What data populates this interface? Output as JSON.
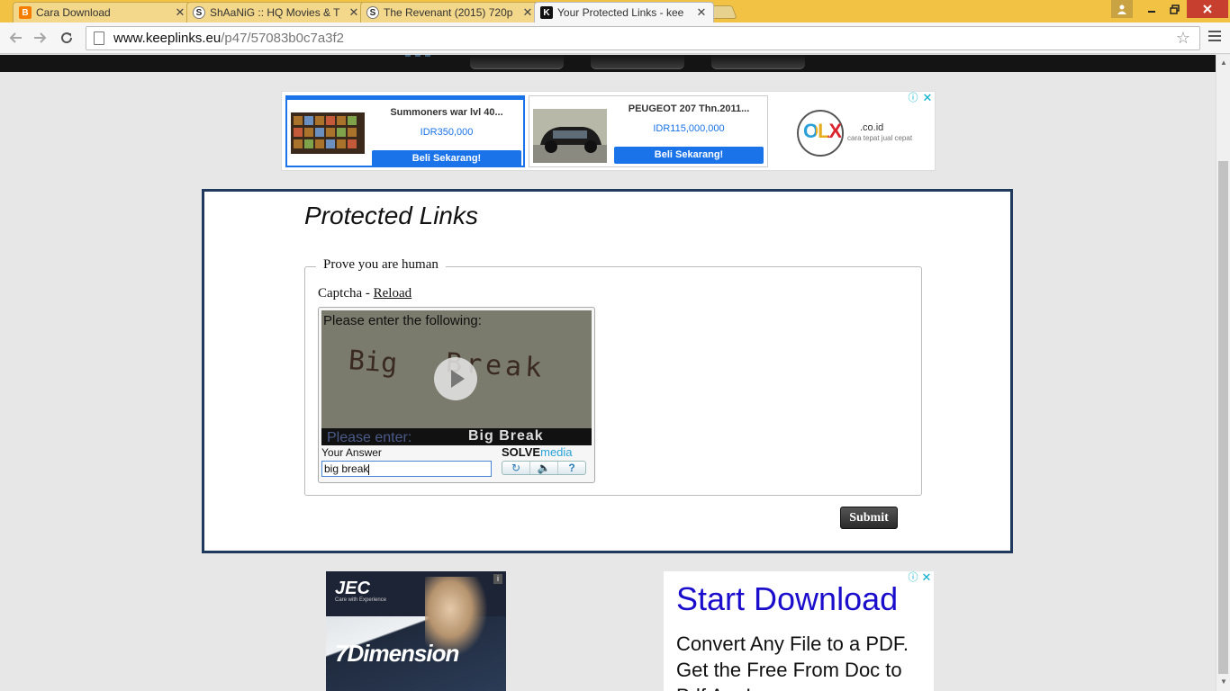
{
  "browser": {
    "tabs": [
      {
        "title": "Cara Download",
        "favicon": "blogger-icon",
        "color": "#f57d00",
        "glyph": "B"
      },
      {
        "title": "ShAaNiG :: HQ Movies & T",
        "favicon": "shaanig-icon",
        "color": "#ffffff",
        "glyph": "S"
      },
      {
        "title": "The Revenant (2015) 720p",
        "favicon": "shaanig-icon",
        "color": "#ffffff",
        "glyph": "S"
      },
      {
        "title": "Your Protected Links - kee",
        "favicon": "keeplinks-icon",
        "color": "#111111",
        "glyph": "K"
      }
    ],
    "close_glyph": "✕",
    "url_host": "www.keeplinks.eu",
    "url_path": "/p47/57083b0c7a3f2"
  },
  "ad_top": {
    "products": [
      {
        "name": "Summoners war lvl 40...",
        "price": "IDR350,000",
        "button": "Beli Sekarang!"
      },
      {
        "name": "PEUGEOT 207 Thn.2011...",
        "price": "IDR115,000,000",
        "button": "Beli Sekarang!"
      }
    ],
    "olx_logo": "OLX",
    "olx_domain": ".co.id",
    "olx_tagline": "cara tepat jual cepat"
  },
  "main": {
    "title": "Protected Links",
    "legend": "Prove you are human",
    "captcha_label": "Captcha - ",
    "reload_link": "Reload",
    "captcha": {
      "instruction": "Please enter the following:",
      "image_word_1": "Big",
      "image_word_2": "Break",
      "bar_prompt": "Please enter:",
      "bar_answer": "Big Break",
      "answer_label": "Your Answer",
      "brand_solve": "SOLVE",
      "brand_media": "media",
      "answer_value": "big break"
    },
    "submit_label": "Submit"
  },
  "ad_bottom_left": {
    "logo": "JEC",
    "sub": "Care with Experience",
    "headline": "7Dimension"
  },
  "ad_bottom_right": {
    "headline": "Start Download",
    "body": "Convert Any File to a PDF. Get the Free From Doc to Pdf App!"
  }
}
